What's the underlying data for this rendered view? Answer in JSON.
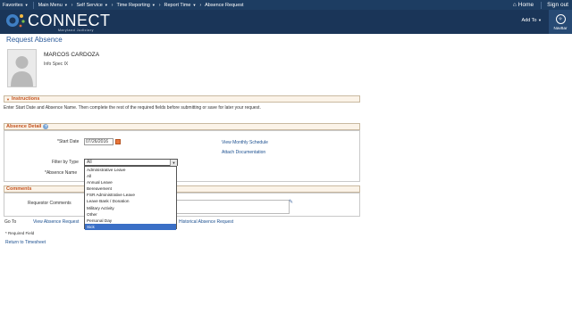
{
  "topnav": {
    "menus": [
      "Favorites",
      "Main Menu",
      "Self Service",
      "Time Reporting",
      "Report Time"
    ],
    "current_page": "Absence Request",
    "home": "Home",
    "sign_out": "Sign out"
  },
  "header": {
    "logo_text": "CONNECT",
    "logo_subtitle": "Maryland Judiciary",
    "add_to": "Add To",
    "navbar": "NavBar"
  },
  "page_title": "Request Absence",
  "employee": {
    "name": "MARCOS CARDOZA",
    "title": "Info Spec IX"
  },
  "instructions": {
    "header": "Instructions",
    "text": "Enter Start Date and Absence Name. Then complete the rest of the required fields before submitting or save for later your request."
  },
  "absence_detail": {
    "header": "Absence Detail",
    "start_date_label": "*Start Date",
    "start_date_value": "07/26/2016",
    "filter_label": "Filter by Type",
    "filter_value": "All",
    "absence_name_label": "*Absence Name",
    "view_monthly_schedule": "View Monthly Schedule",
    "attach_documentation": "Attach Documentation",
    "filter_options": [
      "Administrative Leave",
      "All",
      "Annual Leave",
      "Bereavement",
      "FSR Administrative Leave",
      "Leave Bank / Donation",
      "Military Activity",
      "Other",
      "Personal Day",
      "Sick"
    ],
    "highlighted_option": "Sick"
  },
  "comments": {
    "header": "Comments",
    "requestor_label": "Requestor Comments"
  },
  "footer": {
    "go_to": "Go To",
    "view_absence_request_link": "View Absence Request",
    "historical_link": "Historical Absence Request",
    "required_field": "* Required Field",
    "return_link": "Return to Timesheet"
  },
  "colors": {
    "nav_bg": "#1d3d62",
    "header_bg": "#1a3558",
    "section_title": "#c3501a",
    "link": "#1b4f8f",
    "highlight": "#3a6fc6"
  }
}
